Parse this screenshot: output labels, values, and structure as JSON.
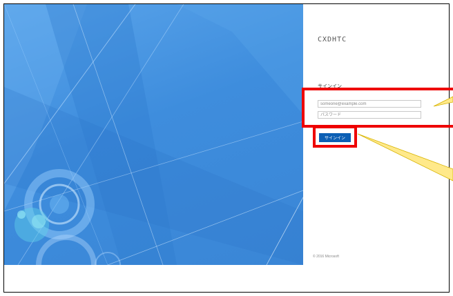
{
  "app": {
    "logo_text": "CXDHTC",
    "signin_heading": "サインイン",
    "email_placeholder": "someone@example.com",
    "password_placeholder": "パスワード",
    "signin_button": "サインイン",
    "copyright": "© 2016 Microsoft"
  },
  "annotation": {
    "highlight_color": "#ee0000",
    "callout_color": "#ffe98a"
  },
  "colors": {
    "background_blue": "#3e8ddd",
    "button_blue": "#0c5fb4"
  }
}
